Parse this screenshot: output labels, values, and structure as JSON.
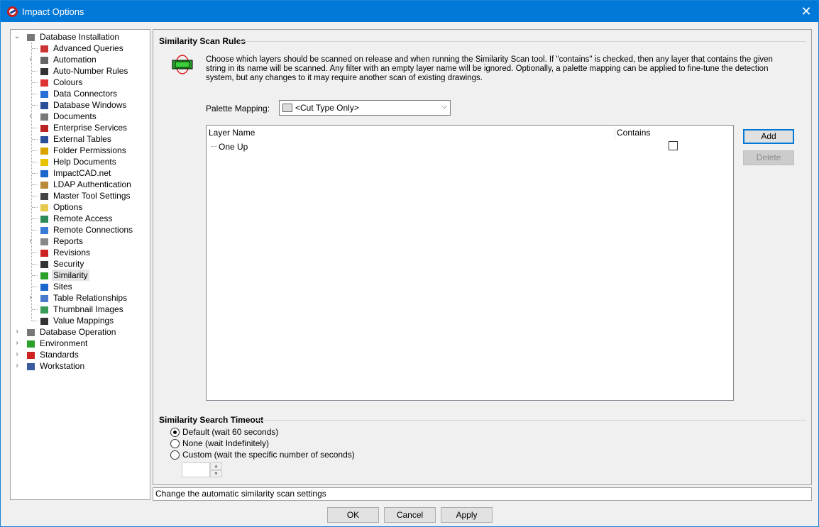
{
  "window": {
    "title": "Impact Options",
    "close_glyph": "✕"
  },
  "tree": {
    "root": {
      "label": "Database Installation",
      "expanded": true
    },
    "children": [
      {
        "label": "Advanced Queries",
        "icon": "sql-icon",
        "expandable": false
      },
      {
        "label": "Automation",
        "icon": "automation-icon",
        "expandable": true
      },
      {
        "label": "Auto-Number Rules",
        "icon": "numbers-icon",
        "expandable": false
      },
      {
        "label": "Colours",
        "icon": "colours-icon",
        "expandable": false
      },
      {
        "label": "Data Connectors",
        "icon": "share-icon",
        "expandable": false
      },
      {
        "label": "Database Windows",
        "icon": "grid-icon",
        "expandable": false
      },
      {
        "label": "Documents",
        "icon": "document-icon",
        "expandable": true
      },
      {
        "label": "Enterprise Services",
        "icon": "enterprise-icon",
        "expandable": false
      },
      {
        "label": "External Tables",
        "icon": "table-icon",
        "expandable": false
      },
      {
        "label": "Folder Permissions",
        "icon": "folder-permission-icon",
        "expandable": false
      },
      {
        "label": "Help Documents",
        "icon": "help-icon",
        "expandable": false
      },
      {
        "label": "ImpactCAD.net",
        "icon": "globe-icon",
        "expandable": false
      },
      {
        "label": "LDAP Authentication",
        "icon": "ldap-icon",
        "expandable": false
      },
      {
        "label": "Master Tool Settings",
        "icon": "tools-icon",
        "expandable": false
      },
      {
        "label": "Options",
        "icon": "options-icon",
        "expandable": false
      },
      {
        "label": "Remote Access",
        "icon": "remote-access-icon",
        "expandable": false
      },
      {
        "label": "Remote Connections",
        "icon": "remote-connections-icon",
        "expandable": false
      },
      {
        "label": "Reports",
        "icon": "report-icon",
        "expandable": true
      },
      {
        "label": "Revisions",
        "icon": "revisions-icon",
        "expandable": false
      },
      {
        "label": "Security",
        "icon": "security-icon",
        "expandable": false
      },
      {
        "label": "Similarity",
        "icon": "similarity-icon",
        "expandable": false,
        "selected": true
      },
      {
        "label": "Sites",
        "icon": "sites-icon",
        "expandable": false
      },
      {
        "label": "Table Relationships",
        "icon": "relationships-icon",
        "expandable": true
      },
      {
        "label": "Thumbnail Images",
        "icon": "image-icon",
        "expandable": false
      },
      {
        "label": "Value Mappings",
        "icon": "arrows-icon",
        "expandable": false
      }
    ],
    "siblings": [
      {
        "label": "Database Operation",
        "icon": "database-icon",
        "expandable": true
      },
      {
        "label": "Environment",
        "icon": "tree-icon",
        "expandable": true
      },
      {
        "label": "Standards",
        "icon": "standards-icon",
        "expandable": true
      },
      {
        "label": "Workstation",
        "icon": "workstation-icon",
        "expandable": true
      }
    ]
  },
  "scan_rules": {
    "title": "Similarity Scan Rules",
    "description": "Choose which layers should be scanned on release and when running the Similarity Scan tool. If \"contains\" is checked, then any layer that contains the given string in its name will be scanned. Any filter with an empty layer name will be ignored. Optionally, a palette mapping can be applied to fine-tune the detection system, but any changes to it may require another scan of existing drawings.",
    "palette_label": "Palette Mapping:",
    "palette_value": "<Cut Type Only>",
    "columns": [
      "Layer Name",
      "Contains"
    ],
    "rows": [
      {
        "layer": "One Up",
        "contains": false
      }
    ],
    "add_label": "Add",
    "delete_label": "Delete"
  },
  "timeout": {
    "title": "Similarity Search Timeout",
    "options": [
      {
        "label": "Default (wait 60 seconds)",
        "selected": true
      },
      {
        "label": "None (wait Indefinitely)",
        "selected": false
      },
      {
        "label": "Custom (wait the specific number of seconds)",
        "selected": false
      }
    ],
    "custom_value": ""
  },
  "status": "Change the automatic similarity scan settings",
  "footer": {
    "ok": "OK",
    "cancel": "Cancel",
    "apply": "Apply"
  },
  "colors": {
    "titlebar": "#0078d7",
    "accent": "#0078d7"
  }
}
